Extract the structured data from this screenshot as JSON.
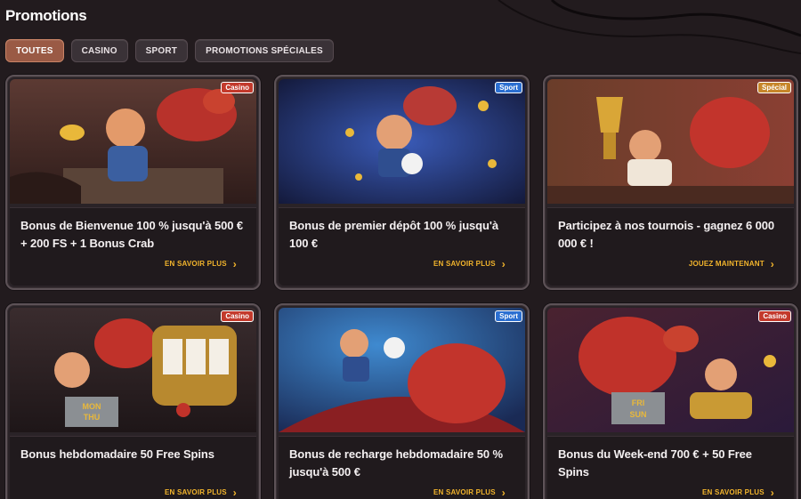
{
  "page": {
    "title": "Promotions"
  },
  "tabs": [
    {
      "label": "TOUTES",
      "active": true
    },
    {
      "label": "CASINO",
      "active": false
    },
    {
      "label": "SPORT",
      "active": false
    },
    {
      "label": "PROMOTIONS SPÉCIALES",
      "active": false
    }
  ],
  "cards": [
    {
      "badge": "Casino",
      "title": "Bonus de Bienvenue 100 % jusqu'à 500 € + 200 FS + 1 Bonus Crab",
      "cta": "EN SAVOIR PLUS"
    },
    {
      "badge": "Sport",
      "title": "Bonus de premier dépôt 100 % jusqu'à 100 €",
      "cta": "EN SAVOIR PLUS"
    },
    {
      "badge": "Spécial",
      "title": "Participez à nos tournois - gagnez 6 000 000 € !",
      "cta": "JOUEZ MAINTENANT"
    },
    {
      "badge": "Casino",
      "title": "Bonus hebdomadaire 50 Free Spins",
      "cta": "EN SAVOIR PLUS"
    },
    {
      "badge": "Sport",
      "title": "Bonus de recharge hebdomadaire 50 % jusqu'à 500 €",
      "cta": "EN SAVOIR PLUS"
    },
    {
      "badge": "Casino",
      "title": "Bonus du Week-end 700 € + 50 Free Spins",
      "cta": "EN SAVOIR PLUS"
    }
  ],
  "art_text": {
    "slot_mon": "MON",
    "slot_thu": "THU",
    "slot_fri": "FRI",
    "slot_sun": "SUN"
  },
  "icons": {
    "cta": "chevron-right-icon"
  },
  "colors": {
    "accent": "#f3b52c",
    "active_tab": "#9a5a45",
    "casino": "#c33a2c",
    "sport": "#2b6fd1",
    "special": "#c7862a"
  }
}
